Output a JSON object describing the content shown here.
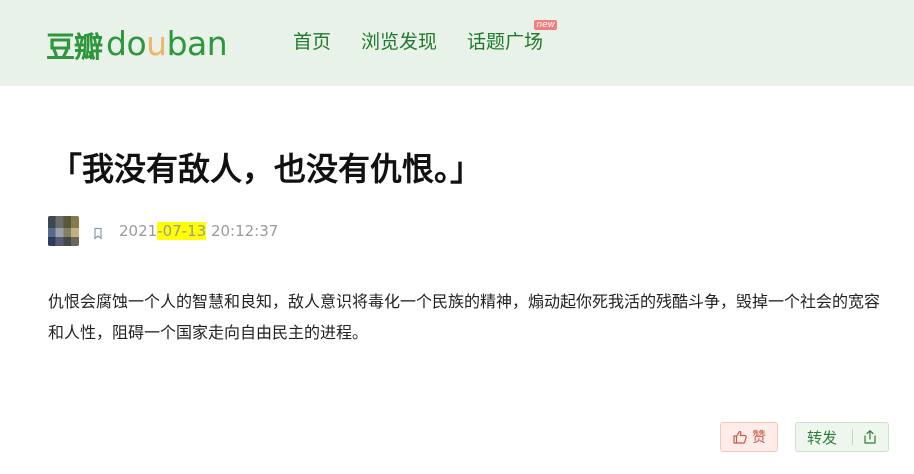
{
  "header": {
    "logo_cn": "豆瓣",
    "logo_en": [
      "do",
      "u",
      "ban"
    ],
    "nav": [
      {
        "label": "首页"
      },
      {
        "label": "浏览发现"
      },
      {
        "label": "话题广场",
        "badge": "new"
      }
    ]
  },
  "post": {
    "title": "「我没有敌人，也没有仇恨。」",
    "meta": {
      "time_prefix": "2021",
      "time_highlight": "-07-13",
      "time_suffix": " 20:12:37"
    },
    "body": "仇恨会腐蚀一个人的智慧和良知，敌人意识将毒化一个民族的精神，煽动起你死我活的残酷斗争，毁掉一个社会的宽容和人性，阻碍一个国家走向自由民主的进程。"
  },
  "actions": {
    "like_label": "赞",
    "share_label": "转发"
  },
  "colors": {
    "header_bg": "#e9f2e9",
    "brand_green": "#2e963d",
    "highlight": "#ffff00"
  },
  "icons": [
    "thumb-up-icon",
    "upload-icon",
    "bookmark-icon"
  ]
}
